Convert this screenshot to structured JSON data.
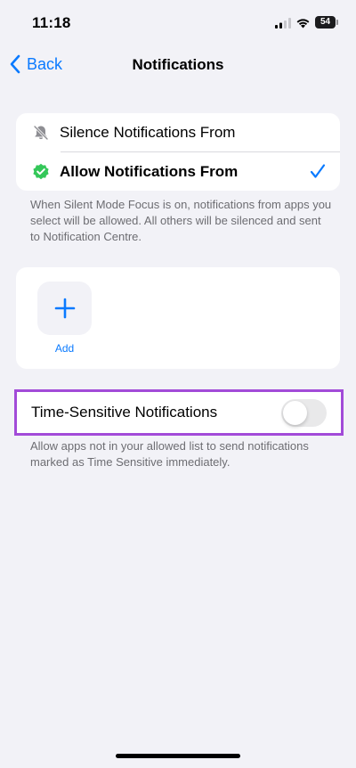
{
  "status_bar": {
    "time": "11:18",
    "battery_level": "54",
    "icons": [
      "cellular-signal-icon",
      "wifi-icon",
      "battery-icon"
    ]
  },
  "nav": {
    "back_label": "Back",
    "title": "Notifications"
  },
  "focus_options": {
    "items": [
      {
        "label": "Silence Notifications From",
        "icon": "bell-slash-icon",
        "selected": false
      },
      {
        "label": "Allow Notifications From",
        "icon": "checkmark-seal-icon",
        "selected": true
      }
    ],
    "footnote": "When Silent Mode  Focus is on, notifications from apps you select will be allowed. All others will be silenced and sent to Notification Centre."
  },
  "allowed_apps": {
    "add_label": "Add"
  },
  "time_sensitive": {
    "label": "Time-Sensitive Notifications",
    "enabled": false,
    "footnote": "Allow apps not in your allowed list to send notifications marked as Time Sensitive immediately."
  },
  "colors": {
    "accent": "#0a7aff",
    "highlight_border": "#a24bd8",
    "success_green": "#34c759",
    "background": "#f2f2f7"
  }
}
